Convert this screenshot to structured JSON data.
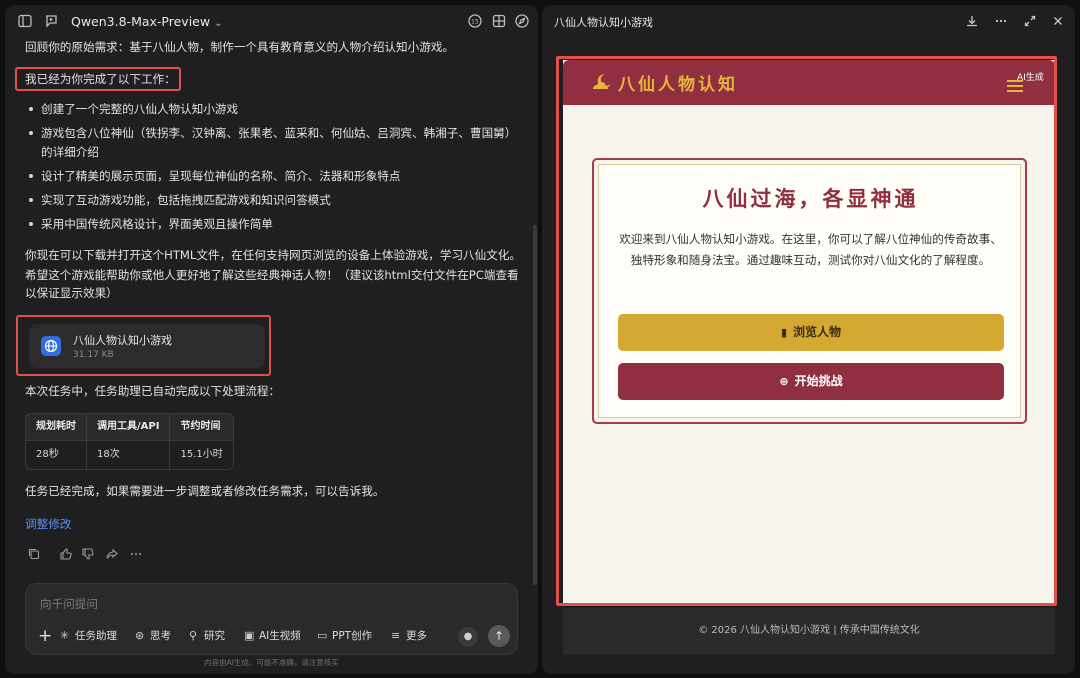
{
  "left": {
    "model_name": "Qwen3.8-Max-Preview",
    "intro": "回顾你的原始需求：基于八仙人物，制作一个具有教育意义的人物介绍认知小游戏。",
    "done_heading": "我已经为你完成了以下工作：",
    "bullets": [
      "创建了一个完整的八仙人物认知小游戏",
      "游戏包含八位神仙（铁拐李、汉钟离、张果老、蓝采和、何仙姑、吕洞宾、韩湘子、曹国舅）",
      "的详细介绍",
      "设计了精美的展示页面，呈现每位神仙的名称、简介、法器和形象特点",
      "实现了互动游戏功能，包括拖拽匹配游戏和知识问答模式",
      "采用中国传统风格设计，界面美观且操作简单"
    ],
    "summary_lines": [
      "你现在可以下载并打开这个HTML文件，在任何支持网页浏览的设备上体验游戏，学习八仙文化。",
      "希望这个游戏能帮助你或他人更好地了解这些经典神话人物！（建议该html交付文件在PC端查看",
      "以保证显示效果）"
    ],
    "file": {
      "name": "八仙人物认知小游戏",
      "size": "31.17 KB"
    },
    "process_intro": "本次任务中，任务助理已自动完成以下处理流程：",
    "table": {
      "headers": [
        "规划耗时",
        "调用工具/API",
        "节约时间"
      ],
      "row": [
        "28秒",
        "18次",
        "15.1小时"
      ]
    },
    "closing": "任务已经完成，如果需要进一步调整或者修改任务需求，可以告诉我。",
    "adjust_link": "调整修改",
    "composer": {
      "placeholder": "向千问提问",
      "tools": [
        "任务助理",
        "思考",
        "研究",
        "AI生视频",
        "PPT创作",
        "更多"
      ]
    },
    "disclaimer": "内容由AI生成，可能不准确，请注意核实"
  },
  "right": {
    "panel_title": "八仙人物认知小游戏",
    "site": {
      "logo_text": "八仙人物认知",
      "ai_tag": "AI生成",
      "card_title": "八仙过海，各显神通",
      "card_text": "欢迎来到八仙人物认知小游戏。在这里，你可以了解八位神仙的传奇故事、独特形象和随身法宝。通过趣味互动，测试你对八仙文化的了解程度。",
      "browse_button": "浏览人物",
      "start_button": "开始挑战",
      "footer": "© 2026 八仙人物认知小游戏 | 传承中国传统文化"
    }
  },
  "colors": {
    "accent_red": "#8f2f40",
    "accent_gold": "#d4a932",
    "highlight_outline": "#e0514a",
    "link_blue": "#5b8ff0"
  }
}
